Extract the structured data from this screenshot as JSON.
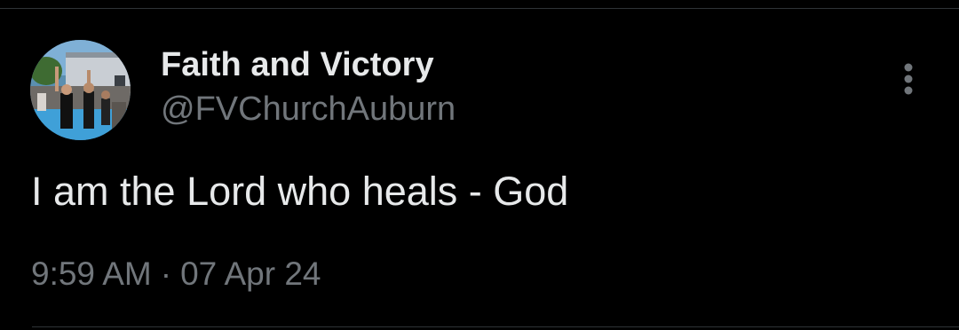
{
  "tweet": {
    "author": {
      "display_name": "Faith and Victory",
      "handle": "@FVChurchAuburn",
      "avatar": "photo of people at an outdoor baptism pool"
    },
    "text": "I am the Lord who heals - God",
    "time": "9:59 AM",
    "separator": "·",
    "date": "07 Apr 24",
    "more_icon": "more-vertical-icon"
  },
  "colors": {
    "background": "#000000",
    "primary_text": "#e7e9ea",
    "secondary_text": "#71767b",
    "divider": "#2f3336"
  }
}
